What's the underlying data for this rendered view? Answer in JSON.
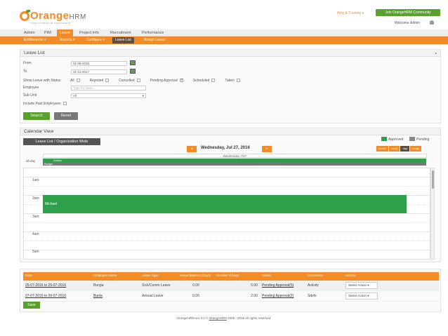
{
  "header": {
    "logo_main": "Orange",
    "logo_suffix": "HRM",
    "tagline": "OPEN SOURCE HR MANAGEMENT",
    "help_link": "Help & Training ▾",
    "join_button": "Join OrangeHRM Community",
    "welcome": "Welcome Admin"
  },
  "main_nav": [
    "Admin",
    "PIM",
    "Leave",
    "Project Info",
    "Recruitment",
    "Performance"
  ],
  "main_nav_active": "Leave",
  "sub_nav": [
    "Entitlements ▾",
    "Reports ▾",
    "Configure ▾",
    "Leave List",
    "Assign Leave"
  ],
  "sub_nav_active": "Leave List",
  "leave_list": {
    "title": "Leave List",
    "collapse_icon": "▴",
    "from_label": "From",
    "from_value": "01-06-2016",
    "to_label": "To",
    "to_value": "31-12-2017",
    "status_label": "Show Leave with Status",
    "statuses": [
      {
        "label": "All",
        "checked": false
      },
      {
        "label": "Rejected",
        "checked": false
      },
      {
        "label": "Cancelled",
        "checked": false
      },
      {
        "label": "Pending Approval",
        "checked": true
      },
      {
        "label": "Scheduled",
        "checked": false
      },
      {
        "label": "Taken",
        "checked": false
      }
    ],
    "employee_label": "Employee",
    "employee_placeholder": "Type for hints...",
    "subunit_label": "Sub Unit",
    "subunit_value": "All",
    "past_label": "Include Past Employees",
    "search_button": "Search",
    "reset_button": "Reset"
  },
  "calendar": {
    "title": "Calendar View",
    "toggle_button": "Leave List / Organization Wide",
    "legend": [
      {
        "label": "Approved",
        "color": "#2fa04a"
      },
      {
        "label": "Pending",
        "color": "#888888"
      }
    ],
    "date_label": "Wednesday, Jul 27, 2016",
    "prev": "◂",
    "next": "▸",
    "views": [
      "month",
      "week",
      "day",
      "today"
    ],
    "active_view": "day",
    "day_header": "Wednesday 7/27",
    "allday_label": "all-day",
    "allday_events": [
      {
        "name": "Sudha",
        "color": "#2fa04a"
      },
      {
        "name": "Bunga",
        "color": "#777777"
      }
    ],
    "time_labels": [
      "1am",
      "2am",
      "3am",
      "4am",
      "5am"
    ],
    "event": {
      "name": "Michael",
      "color": "#2fa04a"
    }
  },
  "table": {
    "headers": [
      "Date",
      "Employee Name",
      "Leave Type",
      "Leave Balance (Days)",
      "Number of Days",
      "Status",
      "Comments",
      "Actions"
    ],
    "rows": [
      {
        "date": "25-07-2016 to 29-07-2016",
        "employee": "Bunga",
        "type": "Sick/Comm Leave",
        "balance": "0.00",
        "days": "5.00",
        "status": "Pending Approval(5)",
        "comments": "Activity",
        "action": "Select Action"
      },
      {
        "date": "07-07-2016 to 09-07-2016",
        "employee": "Bunia",
        "type": "Annual Leave",
        "balance": "0.00",
        "days": "2.00",
        "status": "Pending Approval(2)",
        "comments": "Sdsfs",
        "action": "Select Action"
      }
    ],
    "save_button": "Save"
  },
  "footer": {
    "text_before": "OrangeHRM ver 3.0 © ",
    "link": "OrangeHRM",
    "text_after": " 2005 - 2015 All rights reserved."
  }
}
